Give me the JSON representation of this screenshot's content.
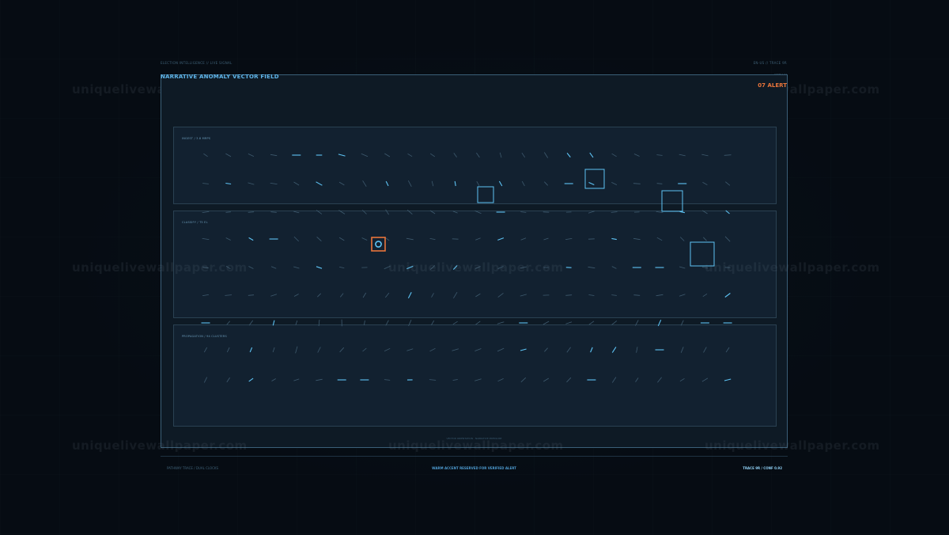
{
  "header": {
    "context_left": "ELECTION INTELLIGENCE // LIVE SIGNAL",
    "context_right": "EN-US // TRACE 9R",
    "alert_meta": "CONF 0.92",
    "title": "NARRATIVE ANOMALY VECTOR FIELD",
    "alert_count": "07 ALERT"
  },
  "panels": [
    {
      "label": "INGEST / 3.8 MRPS"
    },
    {
      "label": "CLASSIFY / T5 EL"
    },
    {
      "label": "PROPAGATION / 94 CLUSTERS"
    }
  ],
  "footer": {
    "caption": "VECTOR ORIENTATION · NARRATIVE PRESSURE",
    "left": "PATHWAY TRACE / DUAL CLOCKS",
    "center": "WARM ACCENT RESERVED FOR VERIFIED ALERT",
    "right": "TRACE 9R / CONF 0.92"
  },
  "watermark": "uniquelivewallpaper.com",
  "colors": {
    "accent": "#5fb4e8",
    "alert": "#e8743a",
    "vector_dim": "#3e5a6e",
    "vector_bright": "#5ec4f5"
  },
  "field": {
    "highlight_boxes": 5,
    "verified_alert_markers": 1
  }
}
